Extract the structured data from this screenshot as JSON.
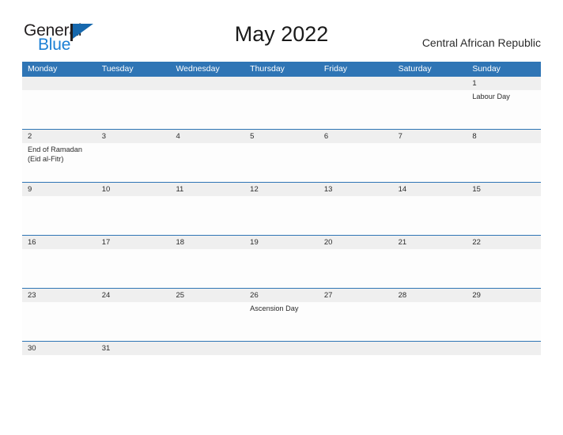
{
  "header": {
    "logo": {
      "word_one": "General",
      "word_two": "Blue"
    },
    "title": "May 2022",
    "country": "Central African Republic"
  },
  "calendar": {
    "weekdays": [
      "Monday",
      "Tuesday",
      "Wednesday",
      "Thursday",
      "Friday",
      "Saturday",
      "Sunday"
    ],
    "colors": {
      "header_blue": "#2f75b5",
      "date_band_gray": "#efefef",
      "cell_white": "#fdfdfd",
      "text_dark": "#2b2b2b",
      "logo_blue": "#1b7fd4"
    },
    "weeks": [
      {
        "cells": [
          {
            "date": "",
            "events": []
          },
          {
            "date": "",
            "events": []
          },
          {
            "date": "",
            "events": []
          },
          {
            "date": "",
            "events": []
          },
          {
            "date": "",
            "events": []
          },
          {
            "date": "",
            "events": []
          },
          {
            "date": "1",
            "events": [
              "Labour Day"
            ]
          }
        ]
      },
      {
        "cells": [
          {
            "date": "2",
            "events": [
              "End of Ramadan",
              "(Eid al-Fitr)"
            ]
          },
          {
            "date": "3",
            "events": []
          },
          {
            "date": "4",
            "events": []
          },
          {
            "date": "5",
            "events": []
          },
          {
            "date": "6",
            "events": []
          },
          {
            "date": "7",
            "events": []
          },
          {
            "date": "8",
            "events": []
          }
        ]
      },
      {
        "cells": [
          {
            "date": "9",
            "events": []
          },
          {
            "date": "10",
            "events": []
          },
          {
            "date": "11",
            "events": []
          },
          {
            "date": "12",
            "events": []
          },
          {
            "date": "13",
            "events": []
          },
          {
            "date": "14",
            "events": []
          },
          {
            "date": "15",
            "events": []
          }
        ]
      },
      {
        "cells": [
          {
            "date": "16",
            "events": []
          },
          {
            "date": "17",
            "events": []
          },
          {
            "date": "18",
            "events": []
          },
          {
            "date": "19",
            "events": []
          },
          {
            "date": "20",
            "events": []
          },
          {
            "date": "21",
            "events": []
          },
          {
            "date": "22",
            "events": []
          }
        ]
      },
      {
        "cells": [
          {
            "date": "23",
            "events": []
          },
          {
            "date": "24",
            "events": []
          },
          {
            "date": "25",
            "events": []
          },
          {
            "date": "26",
            "events": [
              "Ascension Day"
            ]
          },
          {
            "date": "27",
            "events": []
          },
          {
            "date": "28",
            "events": []
          },
          {
            "date": "29",
            "events": []
          }
        ]
      },
      {
        "cells": [
          {
            "date": "30",
            "events": []
          },
          {
            "date": "31",
            "events": []
          },
          {
            "date": "",
            "events": []
          },
          {
            "date": "",
            "events": []
          },
          {
            "date": "",
            "events": []
          },
          {
            "date": "",
            "events": []
          },
          {
            "date": "",
            "events": []
          }
        ]
      }
    ]
  }
}
